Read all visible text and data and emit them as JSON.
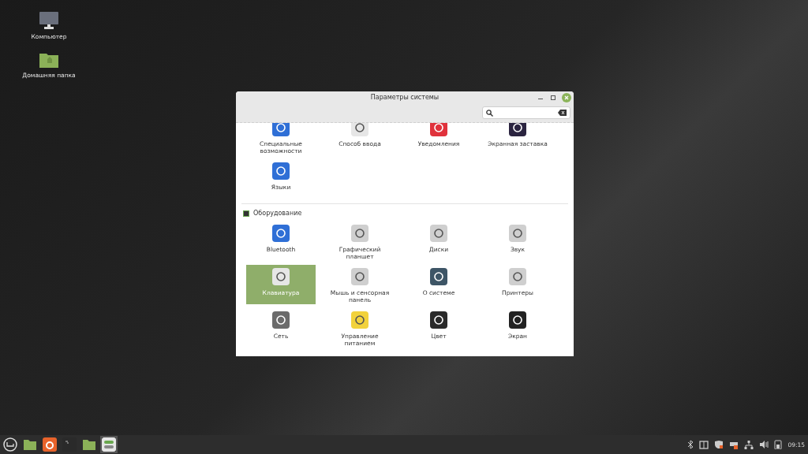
{
  "desktop_icons": [
    {
      "label": "Компьютер"
    },
    {
      "label": "Домашняя папка"
    }
  ],
  "window": {
    "title": "Параметры системы"
  },
  "sections": [
    {
      "items": [
        {
          "label": "Специальные возможности",
          "selected": false
        },
        {
          "label": "Способ ввода",
          "selected": false
        },
        {
          "label": "Уведомления",
          "selected": false
        },
        {
          "label": "Экранная заставка",
          "selected": false
        },
        {
          "label": "Языки",
          "selected": false
        }
      ]
    },
    {
      "heading": "Оборудование",
      "items": [
        {
          "label": "Bluetooth",
          "selected": false
        },
        {
          "label": "Графический планшет",
          "selected": false
        },
        {
          "label": "Диски",
          "selected": false
        },
        {
          "label": "Звук",
          "selected": false
        },
        {
          "label": "Клавиатура",
          "selected": true
        },
        {
          "label": "Мышь и сенсорная панель",
          "selected": false
        },
        {
          "label": "О системе",
          "selected": false
        },
        {
          "label": "Принтеры",
          "selected": false
        },
        {
          "label": "Сеть",
          "selected": false
        },
        {
          "label": "Управление питанием",
          "selected": false
        },
        {
          "label": "Цвет",
          "selected": false
        },
        {
          "label": "Экран",
          "selected": false
        }
      ]
    }
  ],
  "taskbar": {
    "clock": "09:15"
  }
}
